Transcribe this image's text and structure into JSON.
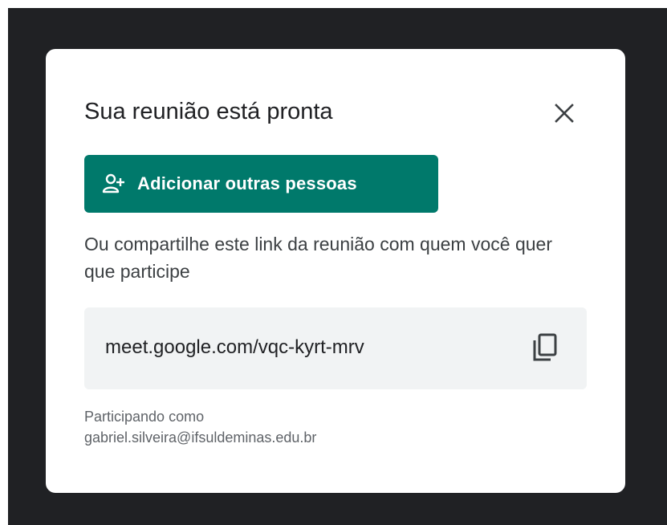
{
  "dialog": {
    "title": "Sua reunião está pronta",
    "close_icon": "close-icon",
    "add_button": {
      "label": "Adicionar outras pessoas",
      "icon": "add-person-icon"
    },
    "share_text": "Ou compartilhe este link da reunião com quem você quer que participe",
    "meeting_link": "meet.google.com/vqc-kyrt-mrv",
    "copy_icon": "copy-icon",
    "participant_label": "Participando como",
    "participant_email": "gabriel.silveira@ifsuldeminas.edu.br"
  },
  "colors": {
    "backdrop": "#202124",
    "accent": "#00796b",
    "link_box_bg": "#f1f3f4",
    "title_text": "#202124",
    "secondary_text": "#5f6368"
  }
}
